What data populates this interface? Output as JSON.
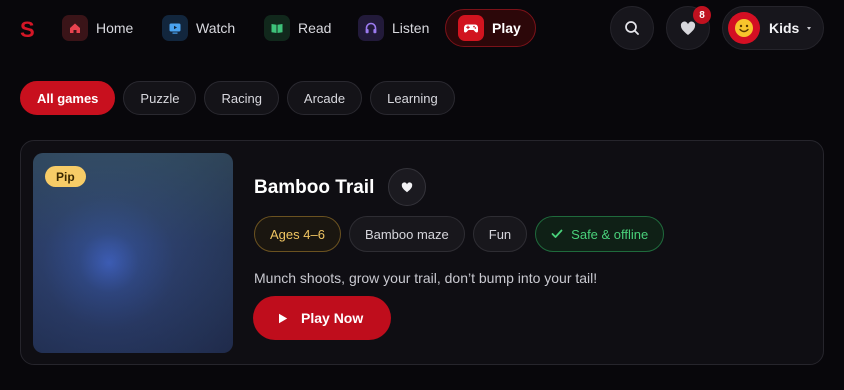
{
  "app": {
    "logo": "S"
  },
  "nav": [
    {
      "label": "Home",
      "icon": "home-icon",
      "color": "#e8434f",
      "bg": "#3a1418"
    },
    {
      "label": "Watch",
      "icon": "tv-icon",
      "color": "#4aa3f0",
      "bg": "#12263d"
    },
    {
      "label": "Read",
      "icon": "book-icon",
      "color": "#3ec27a",
      "bg": "#11281c"
    },
    {
      "label": "Listen",
      "icon": "headphones-icon",
      "color": "#9b7af0",
      "bg": "#221a3a"
    },
    {
      "label": "Play",
      "icon": "gamepad-icon",
      "color": "#ffffff",
      "bg": "#d1141f",
      "active": true
    }
  ],
  "header": {
    "search_icon": "search-icon",
    "favorites_icon": "heart-icon",
    "favorites_count": "8",
    "profile_label": "Kids",
    "avatar_icon": "smiley-face-icon"
  },
  "filters": [
    {
      "label": "All games",
      "active": true
    },
    {
      "label": "Puzzle"
    },
    {
      "label": "Racing"
    },
    {
      "label": "Arcade"
    },
    {
      "label": "Learning"
    }
  ],
  "featured": {
    "character_badge": "Pip",
    "title": "Bamboo Trail",
    "tags": {
      "age": "Ages 4–6",
      "genre": "Bamboo maze",
      "mood": "Fun",
      "safety": "Safe & offline"
    },
    "description": "Munch shoots, grow your trail, don’t bump into your tail!",
    "play_label": "Play Now"
  },
  "colors": {
    "accent": "#c8101e",
    "background": "#08070b",
    "age_tag": "#f0c562",
    "safe_tag": "#49d07a"
  }
}
